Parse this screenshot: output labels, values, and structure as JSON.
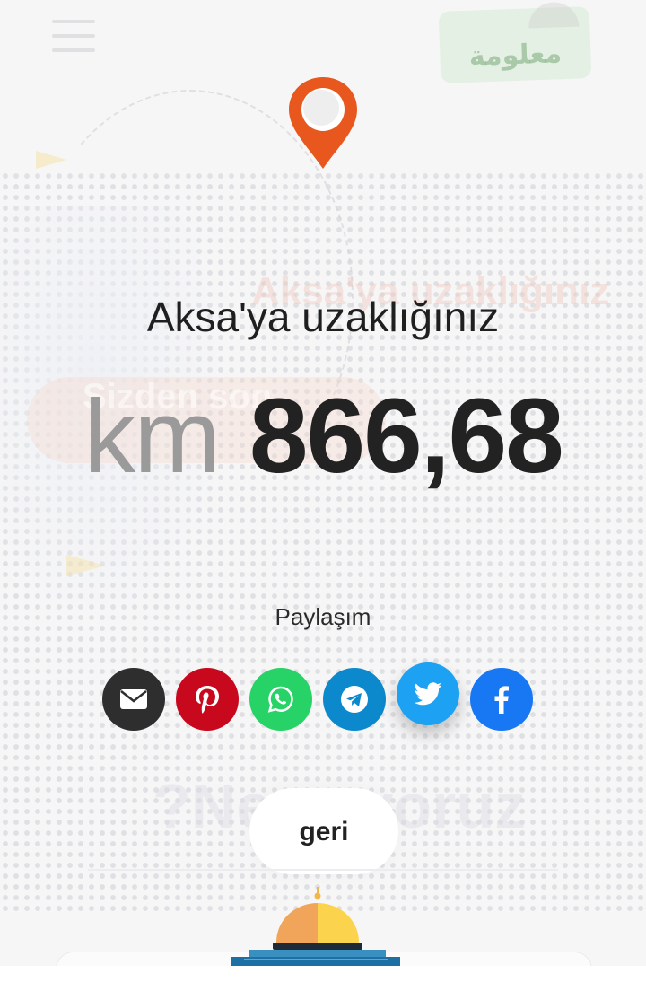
{
  "header": {
    "menu_icon": "hamburger-menu-icon",
    "logo_text": "معلومة",
    "logo_icon": "dome-of-rock-logo"
  },
  "background": {
    "watermark_line_1": "Aksa'ya uzaklığınız",
    "watermark_line_2": "Sizden son",
    "watermark_line_3": "?Ne ... yoruz"
  },
  "result": {
    "pin_icon": "location-pin-icon",
    "title": "Aksa'ya uzaklığınız",
    "unit": "km",
    "value": "866,68"
  },
  "share": {
    "label": "Paylaşım",
    "buttons": [
      {
        "name": "email",
        "icon": "email-icon",
        "color": "#2e2e2e"
      },
      {
        "name": "pinterest",
        "icon": "pinterest-icon",
        "color": "#c8081d"
      },
      {
        "name": "whatsapp",
        "icon": "whatsapp-icon",
        "color": "#27d366"
      },
      {
        "name": "telegram",
        "icon": "telegram-icon",
        "color": "#0c88cc"
      },
      {
        "name": "twitter",
        "icon": "twitter-icon",
        "color": "#1da1f2"
      },
      {
        "name": "facebook",
        "icon": "facebook-icon",
        "color": "#1877f2"
      }
    ]
  },
  "footer": {
    "back_label": "geri",
    "dome_icon": "al-aqsa-dome-icon"
  },
  "colors": {
    "pin": "#e8581e",
    "text_dark": "#222222",
    "unit_gray": "#9a9a9a"
  }
}
